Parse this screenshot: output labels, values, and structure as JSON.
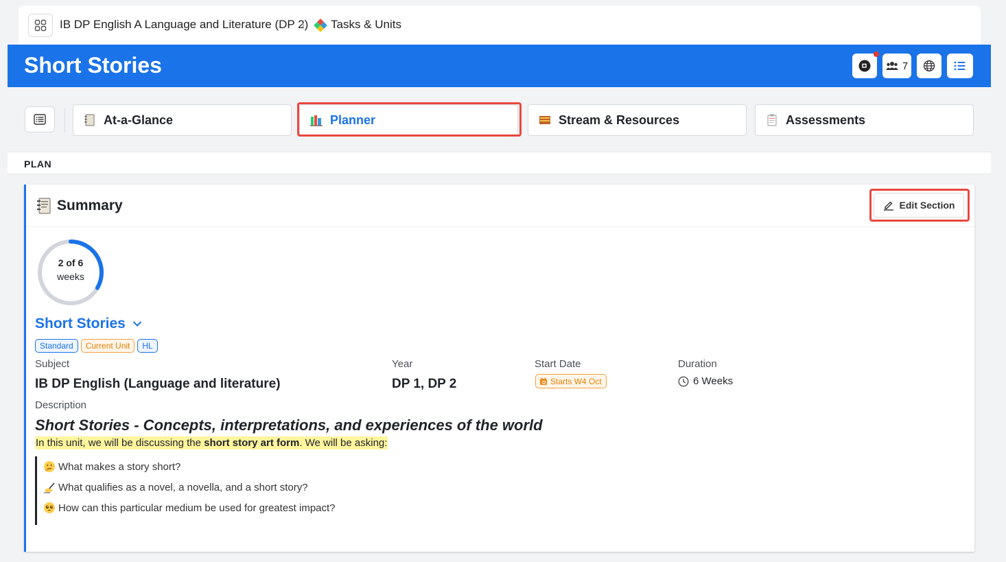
{
  "breadcrumb": {
    "course": "IB DP English A Language and Literature (DP 2)",
    "section": "Tasks & Units"
  },
  "header": {
    "title": "Short Stories",
    "members_count": "7"
  },
  "tabs": [
    {
      "label": "At-a-Glance",
      "active": false
    },
    {
      "label": "Planner",
      "active": true
    },
    {
      "label": "Stream & Resources",
      "active": false
    },
    {
      "label": "Assessments",
      "active": false
    }
  ],
  "plan_label": "PLAN",
  "summary": {
    "title": "Summary",
    "edit_label": "Edit Section",
    "progress": {
      "current": 2,
      "total": 6,
      "text_line1": "2 of 6",
      "text_line2": "weeks"
    },
    "unit_title": "Short Stories",
    "tags": [
      "Standard",
      "Current Unit",
      "HL"
    ],
    "fields": {
      "subject_label": "Subject",
      "subject_value": "IB DP English (Language and literature)",
      "year_label": "Year",
      "year_value": "DP 1, DP 2",
      "start_label": "Start Date",
      "start_value": "Starts W4 Oct",
      "duration_label": "Duration",
      "duration_value": "6 Weeks"
    },
    "description": {
      "label": "Description",
      "heading": "Short Stories - Concepts, interpretations, and experiences of the world",
      "intro_before": "In this unit, we will be discussing the ",
      "intro_bold": "short story art form",
      "intro_after": ". We will be asking:",
      "questions": [
        {
          "icon": "thinking-face-icon",
          "text": "What makes a story short?"
        },
        {
          "icon": "writing-hand-icon",
          "text": "What qualifies as a novel, a novella, and a short story?"
        },
        {
          "icon": "pleading-face-icon",
          "text": "How can this particular medium be used for greatest impact?"
        }
      ]
    }
  }
}
